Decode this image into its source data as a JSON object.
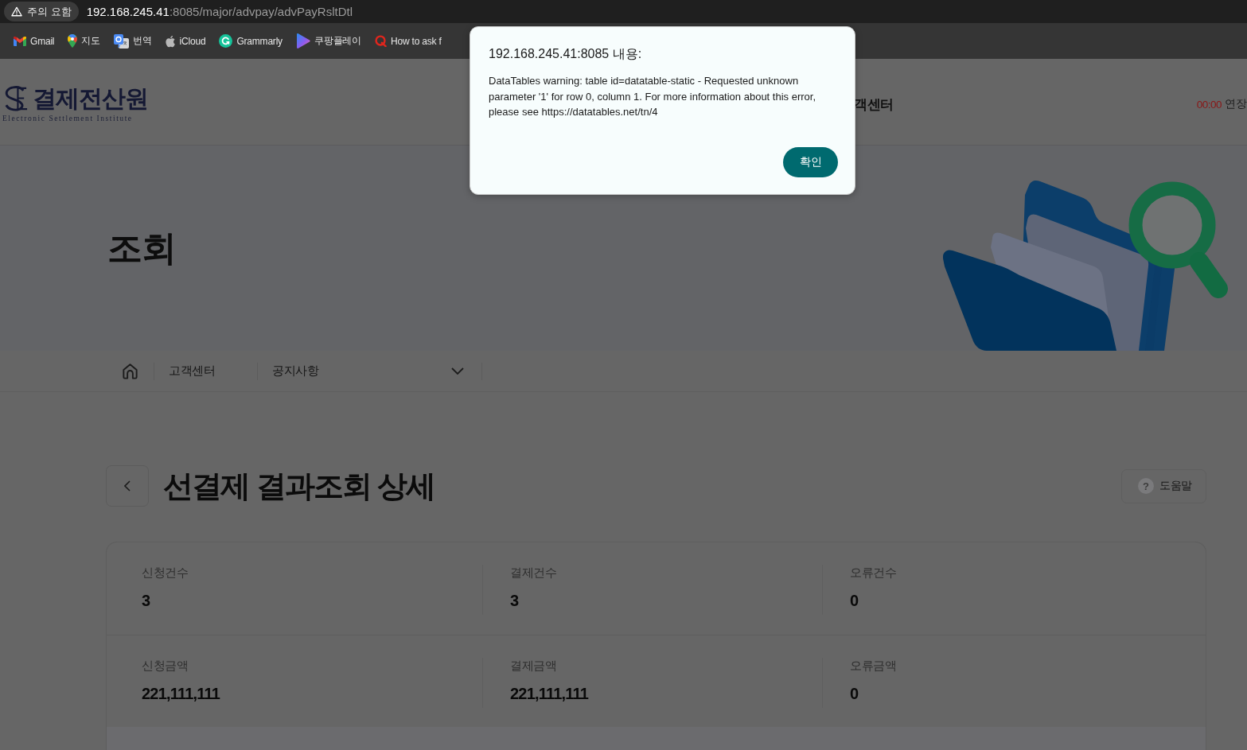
{
  "browser": {
    "security_label": "주의 요함",
    "url_host": "192.168.245.41",
    "url_rest": ":8085/major/advpay/advPayRsltDtl"
  },
  "bookmarks": [
    {
      "kind": "mail",
      "label": "Gmail"
    },
    {
      "kind": "pin",
      "label": "지도"
    },
    {
      "kind": "translate",
      "label": "번역"
    },
    {
      "kind": "apple",
      "label": "iCloud"
    },
    {
      "kind": "g",
      "label": "Grammarly"
    },
    {
      "kind": "play",
      "label": "쿠팡플레이"
    },
    {
      "kind": "q",
      "label": "How to ask f"
    }
  ],
  "header": {
    "logo_name": "결제전산원",
    "logo_subtitle": "Electronic Settlement Institute",
    "nav": [
      "객센터"
    ],
    "timer": "00:00",
    "extend": "연장"
  },
  "hero": {
    "title": "조회"
  },
  "breadcrumb": {
    "items": [
      {
        "kind": "link",
        "label": "고객센터"
      },
      {
        "kind": "dropdown",
        "label": "공지사항"
      }
    ]
  },
  "page": {
    "title": "선결제 결과조회 상세",
    "help_icon": "?",
    "help": "도움말"
  },
  "summary": {
    "rows": [
      [
        {
          "label": "신청건수",
          "value": "3"
        },
        {
          "label": "결제건수",
          "value": "3"
        },
        {
          "label": "오류건수",
          "value": "0"
        }
      ],
      [
        {
          "label": "신청금액",
          "value": "221,111,111"
        },
        {
          "label": "결제금액",
          "value": "221,111,111"
        },
        {
          "label": "오류금액",
          "value": "0"
        }
      ]
    ]
  },
  "dialog": {
    "title": "192.168.245.41:8085 내용:",
    "message": "DataTables warning: table id=datatable-static - Requested unknown parameter '1' for row 0, column 1. For more information about this error, please see https://datatables.net/tn/4",
    "button": "확인"
  }
}
